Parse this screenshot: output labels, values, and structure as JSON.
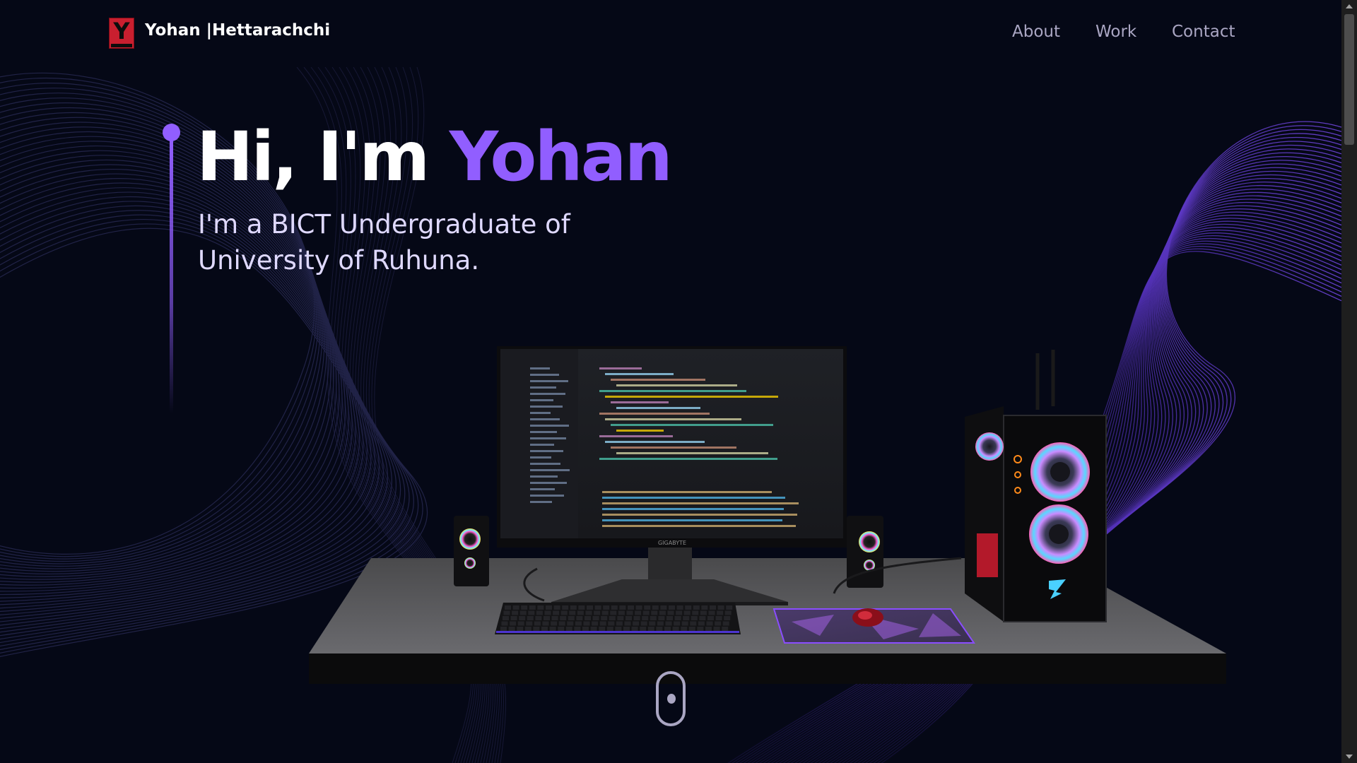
{
  "brand": {
    "name": "Yohan |Hettarachchi",
    "logo_letter": "Y"
  },
  "nav": {
    "items": [
      {
        "label": "About"
      },
      {
        "label": "Work"
      },
      {
        "label": "Contact"
      }
    ]
  },
  "hero": {
    "greeting": "Hi, I'm",
    "name": "Yohan",
    "subtitle": "I'm a BICT Undergraduate of University of Ruhuna."
  },
  "scene": {
    "monitor_brand": "GIGABYTE"
  },
  "colors": {
    "background": "#050816",
    "accent": "#915eff",
    "nav_text": "#aaa6c3",
    "subtitle_text": "#dfd9ff"
  },
  "icons": {
    "scroll_indicator": "mouse-scroll-icon"
  }
}
